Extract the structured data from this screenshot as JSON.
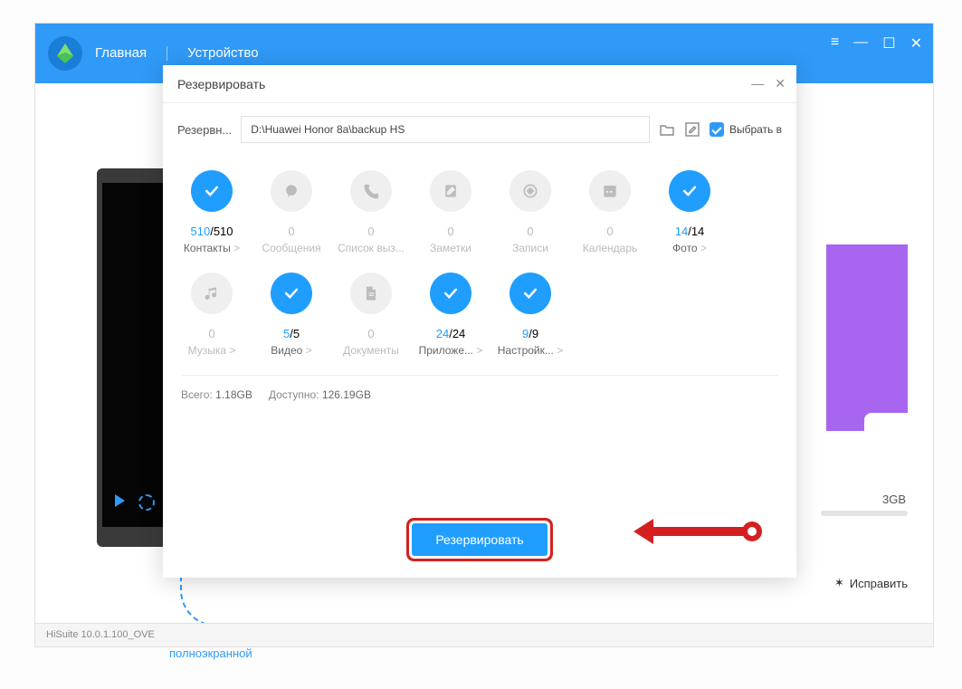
{
  "header": {
    "nav_home": "Главная",
    "nav_device": "Устройство"
  },
  "footer": {
    "version": "HiSuite 10.0.1.100_OVE"
  },
  "side": {
    "gb": "3GB",
    "fix": "Исправить",
    "fullscreen": "полноэкранной"
  },
  "dialog": {
    "title": "Резервировать",
    "path_label": "Резервн...",
    "path_value": "D:\\Huawei Honor 8a\\backup HS",
    "select_all": "Выбрать в",
    "totals_label": "Всего:",
    "totals_value": "1.18GB",
    "avail_label": "Доступно:",
    "avail_value": "126.19GB",
    "backup_btn": "Резервировать"
  },
  "cats": [
    {
      "label": "Контакты",
      "sel": "510",
      "tot": "510",
      "on": true,
      "chev": true,
      "icon": "check"
    },
    {
      "label": "Сообщения",
      "sel": "0",
      "tot": "",
      "on": false,
      "chev": false,
      "icon": "msg"
    },
    {
      "label": "Список выз...",
      "sel": "0",
      "tot": "",
      "on": false,
      "chev": false,
      "icon": "call"
    },
    {
      "label": "Заметки",
      "sel": "0",
      "tot": "",
      "on": false,
      "chev": false,
      "icon": "note"
    },
    {
      "label": "Записи",
      "sel": "0",
      "tot": "",
      "on": false,
      "chev": false,
      "icon": "rec"
    },
    {
      "label": "Календарь",
      "sel": "0",
      "tot": "",
      "on": false,
      "chev": false,
      "icon": "cal"
    },
    {
      "label": "Фото",
      "sel": "14",
      "tot": "14",
      "on": true,
      "chev": true,
      "icon": "check"
    },
    {
      "label": "Музыка",
      "sel": "0",
      "tot": "",
      "on": false,
      "chev": true,
      "icon": "music"
    },
    {
      "label": "Видео",
      "sel": "5",
      "tot": "5",
      "on": true,
      "chev": true,
      "icon": "check"
    },
    {
      "label": "Документы",
      "sel": "0",
      "tot": "",
      "on": false,
      "chev": false,
      "icon": "doc"
    },
    {
      "label": "Приложе...",
      "sel": "24",
      "tot": "24",
      "on": true,
      "chev": true,
      "icon": "check"
    },
    {
      "label": "Настройк...",
      "sel": "9",
      "tot": "9",
      "on": true,
      "chev": true,
      "icon": "check"
    }
  ]
}
